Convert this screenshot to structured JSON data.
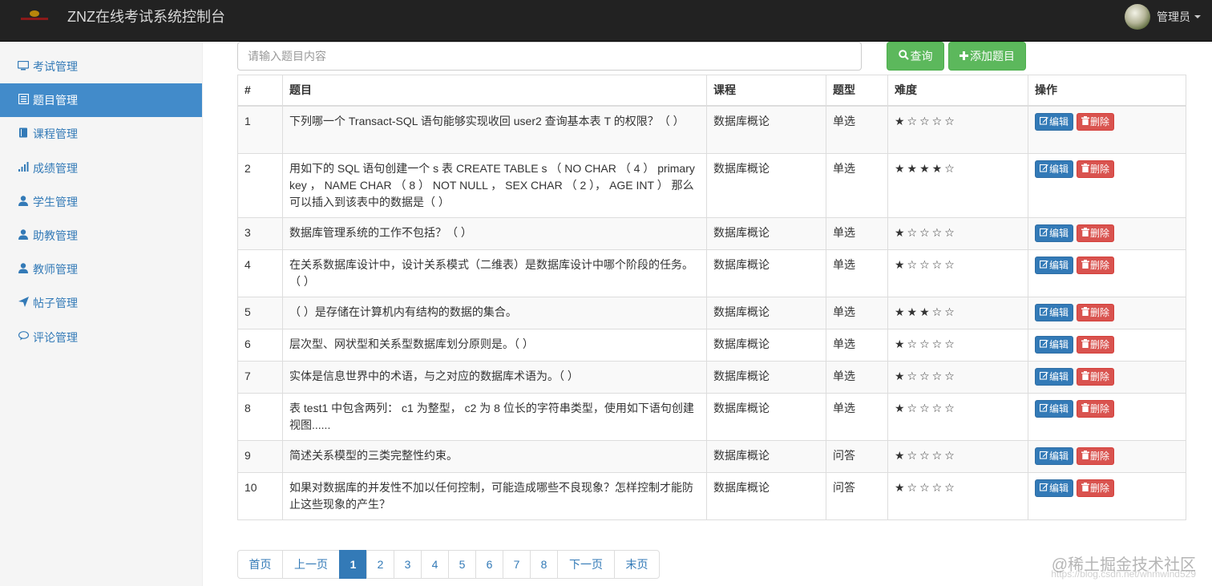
{
  "header": {
    "brand": "ZNZ在线考试系统控制台",
    "user_name": "管理员"
  },
  "sidebar": {
    "items": [
      {
        "label": "考试管理",
        "icon": "monitor-icon",
        "active": false
      },
      {
        "label": "题目管理",
        "icon": "list-alt-icon",
        "active": true
      },
      {
        "label": "课程管理",
        "icon": "book-icon",
        "active": false
      },
      {
        "label": "成绩管理",
        "icon": "signal-icon",
        "active": false
      },
      {
        "label": "学生管理",
        "icon": "user-icon",
        "active": false
      },
      {
        "label": "助教管理",
        "icon": "user-icon",
        "active": false
      },
      {
        "label": "教师管理",
        "icon": "user-icon",
        "active": false
      },
      {
        "label": "帖子管理",
        "icon": "send-icon",
        "active": false
      },
      {
        "label": "评论管理",
        "icon": "comment-icon",
        "active": false
      }
    ]
  },
  "search": {
    "placeholder": "请输入题目内容",
    "query_label": "查询",
    "add_label": "添加题目"
  },
  "table": {
    "headers": [
      "#",
      "题目",
      "课程",
      "题型",
      "难度",
      "操作"
    ],
    "edit_label": "编辑",
    "delete_label": "删除",
    "rows": [
      {
        "id": "1",
        "question": "下列哪一个 Transact-SQL 语句能够实现收回 user2 查询基本表 T 的权限？（ ）",
        "course": "数据库概论",
        "type": "单选",
        "difficulty": 1
      },
      {
        "id": "2",
        "question": "用如下的 SQL 语句创建一个 s 表 CREATE TABLE s （ NO CHAR （ 4 ） primary key ， NAME CHAR （ 8 ） NOT NULL ， SEX CHAR （ 2 ）， AGE INT ） 那么可以插入到该表中的数据是（ ）",
        "course": "数据库概论",
        "type": "单选",
        "difficulty": 4
      },
      {
        "id": "3",
        "question": "数据库管理系统的工作不包括？（ ）",
        "course": "数据库概论",
        "type": "单选",
        "difficulty": 1
      },
      {
        "id": "4",
        "question": "在关系数据库设计中，设计关系模式（二维表）是数据库设计中哪个阶段的任务。（ ）",
        "course": "数据库概论",
        "type": "单选",
        "difficulty": 1
      },
      {
        "id": "5",
        "question": "（ ）是存储在计算机内有结构的数据的集合。",
        "course": "数据库概论",
        "type": "单选",
        "difficulty": 3
      },
      {
        "id": "6",
        "question": "层次型、网状型和关系型数据库划分原则是。（ ）",
        "course": "数据库概论",
        "type": "单选",
        "difficulty": 1
      },
      {
        "id": "7",
        "question": "实体是信息世界中的术语，与之对应的数据库术语为。（ ）",
        "course": "数据库概论",
        "type": "单选",
        "difficulty": 1
      },
      {
        "id": "8",
        "question": "表 test1 中包含两列： c1 为整型， c2 为 8 位长的字符串类型，使用如下语句创建视图......",
        "course": "数据库概论",
        "type": "单选",
        "difficulty": 1
      },
      {
        "id": "9",
        "question": "简述关系模型的三类完整性约束。",
        "course": "数据库概论",
        "type": "问答",
        "difficulty": 1
      },
      {
        "id": "10",
        "question": "如果对数据库的并发性不加以任何控制，可能造成哪些不良现象？怎样控制才能防止这些现象的产生？",
        "course": "数据库概论",
        "type": "问答",
        "difficulty": 1
      }
    ]
  },
  "pagination": {
    "first": "首页",
    "prev": "上一页",
    "pages": [
      "1",
      "2",
      "3",
      "4",
      "5",
      "6",
      "7",
      "8"
    ],
    "current": "1",
    "next": "下一页",
    "last": "末页"
  },
  "watermark": {
    "main": "@稀土掘金技术社区",
    "sub": "https://blog.csdn.net/whmwind529"
  },
  "colors": {
    "navbar": "#222222",
    "primary": "#337ab7",
    "active_nav": "#428bca",
    "success": "#5cb85c",
    "danger": "#d9534f"
  }
}
